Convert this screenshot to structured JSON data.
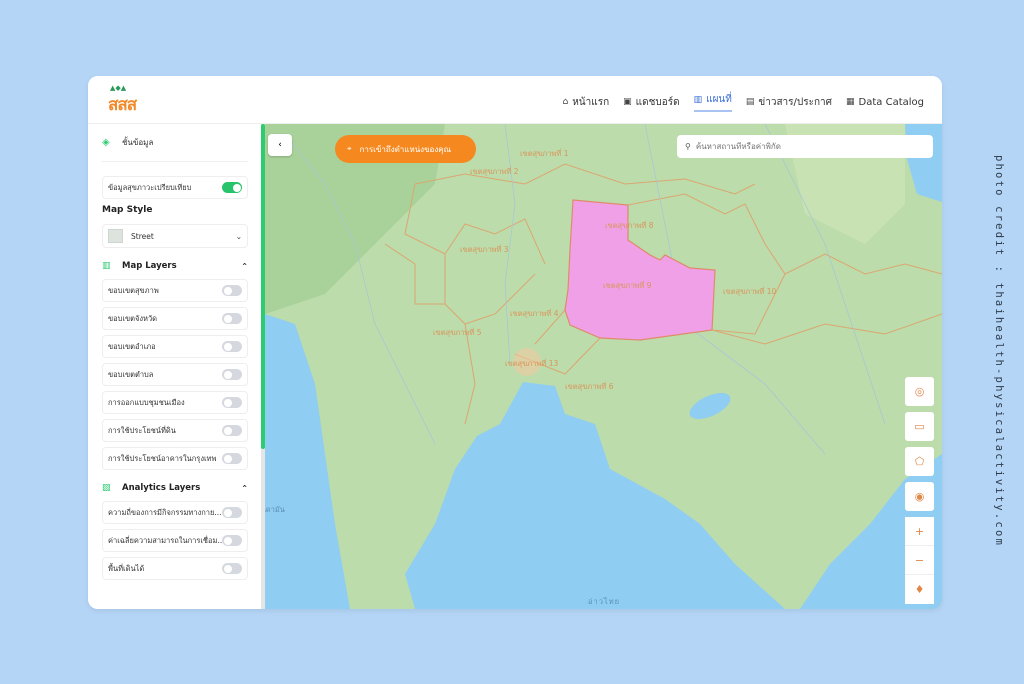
{
  "header": {
    "logo_text": "สสส",
    "nav": [
      {
        "label": "หน้าแรก",
        "icon": "home-icon"
      },
      {
        "label": "แดชบอร์ด",
        "icon": "dashboard-icon"
      },
      {
        "label": "แผนที่",
        "icon": "map-icon",
        "active": true
      },
      {
        "label": "ข่าวสาร/ประกาศ",
        "icon": "news-icon"
      },
      {
        "label": "Data Catalog",
        "icon": "catalog-icon"
      }
    ]
  },
  "sidebar": {
    "layers_title": "ชั้นข้อมูล",
    "compare_label": "ข้อมูลสุขภาวะเปรียบเทียบ",
    "compare_on": true,
    "map_style_title": "Map Style",
    "map_style_value": "Street",
    "map_layers_title": "Map Layers",
    "map_layers": [
      {
        "label": "ขอบเขตสุขภาพ",
        "on": false
      },
      {
        "label": "ขอบเขตจังหวัด",
        "on": false
      },
      {
        "label": "ขอบเขตอำเภอ",
        "on": false
      },
      {
        "label": "ขอบเขตตำบล",
        "on": false
      },
      {
        "label": "การออกแบบชุมชนเมือง",
        "on": false
      },
      {
        "label": "การใช้ประโยชน์ที่ดิน",
        "on": false
      },
      {
        "label": "การใช้ประโยชน์อาคารในกรุงเทพ",
        "on": false
      }
    ],
    "analytics_title": "Analytics Layers",
    "analytics_layers": [
      {
        "label": "ความถี่ของการมีกิจกรรมทางกาย...",
        "on": false
      },
      {
        "label": "ค่าเฉลี่ยความสามารถในการเชื่อม...",
        "on": false
      },
      {
        "label": "พื้นที่เดินได้",
        "on": false
      }
    ]
  },
  "map": {
    "collapse_icon": "‹",
    "location_button": "การเข้าถึงตำแหน่งของคุณ",
    "search_placeholder": "ค้นหาสถานที่หรือค่าพิกัด",
    "labels": {
      "z1": "เขตสุขภาพที่ 1",
      "z2": "เขตสุขภาพที่ 2",
      "z3": "เขตสุขภาพที่ 3",
      "z4": "เขตสุขภาพที่ 4",
      "z5": "เขตสุขภาพที่ 5",
      "z6": "เขตสุขภาพที่ 6",
      "z8": "เขตสุขภาพที่ 8",
      "z9": "เขตสุขภาพที่ 9",
      "z10": "เขตสุขภาพที่ 10",
      "z13": "เขตสุขภาพที่ 13",
      "andaman": "ทะเลอันดามัน",
      "gulf": "อ่าวไทย"
    },
    "highlight_color": "#f0a0e6",
    "controls": [
      "geolocate-icon",
      "ruler-icon",
      "polygon-icon",
      "target-icon",
      "zoom-in-icon",
      "zoom-out-icon",
      "compass-icon"
    ]
  },
  "credit": "photo credit : thaihealth-physicalactivity.com"
}
